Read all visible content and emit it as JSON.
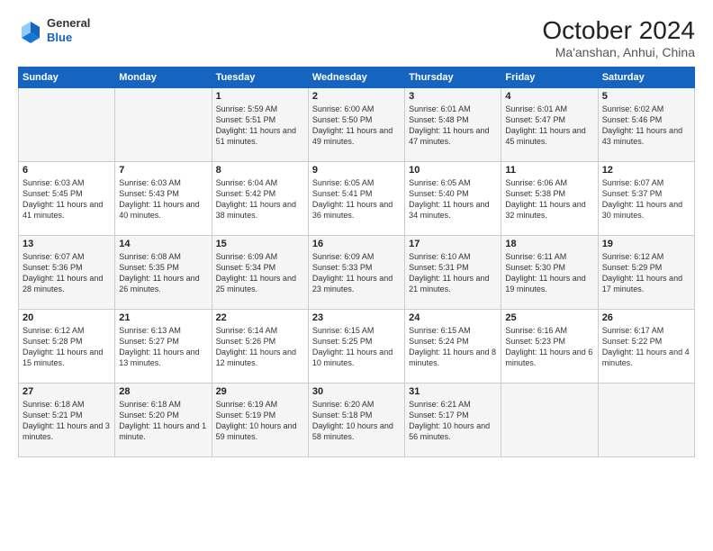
{
  "logo": {
    "general": "General",
    "blue": "Blue"
  },
  "title": {
    "month_year": "October 2024",
    "location": "Ma'anshan, Anhui, China"
  },
  "days_of_week": [
    "Sunday",
    "Monday",
    "Tuesday",
    "Wednesday",
    "Thursday",
    "Friday",
    "Saturday"
  ],
  "weeks": [
    [
      {
        "day": "",
        "info": ""
      },
      {
        "day": "",
        "info": ""
      },
      {
        "day": "1",
        "info": "Sunrise: 5:59 AM\nSunset: 5:51 PM\nDaylight: 11 hours and 51 minutes."
      },
      {
        "day": "2",
        "info": "Sunrise: 6:00 AM\nSunset: 5:50 PM\nDaylight: 11 hours and 49 minutes."
      },
      {
        "day": "3",
        "info": "Sunrise: 6:01 AM\nSunset: 5:48 PM\nDaylight: 11 hours and 47 minutes."
      },
      {
        "day": "4",
        "info": "Sunrise: 6:01 AM\nSunset: 5:47 PM\nDaylight: 11 hours and 45 minutes."
      },
      {
        "day": "5",
        "info": "Sunrise: 6:02 AM\nSunset: 5:46 PM\nDaylight: 11 hours and 43 minutes."
      }
    ],
    [
      {
        "day": "6",
        "info": "Sunrise: 6:03 AM\nSunset: 5:45 PM\nDaylight: 11 hours and 41 minutes."
      },
      {
        "day": "7",
        "info": "Sunrise: 6:03 AM\nSunset: 5:43 PM\nDaylight: 11 hours and 40 minutes."
      },
      {
        "day": "8",
        "info": "Sunrise: 6:04 AM\nSunset: 5:42 PM\nDaylight: 11 hours and 38 minutes."
      },
      {
        "day": "9",
        "info": "Sunrise: 6:05 AM\nSunset: 5:41 PM\nDaylight: 11 hours and 36 minutes."
      },
      {
        "day": "10",
        "info": "Sunrise: 6:05 AM\nSunset: 5:40 PM\nDaylight: 11 hours and 34 minutes."
      },
      {
        "day": "11",
        "info": "Sunrise: 6:06 AM\nSunset: 5:38 PM\nDaylight: 11 hours and 32 minutes."
      },
      {
        "day": "12",
        "info": "Sunrise: 6:07 AM\nSunset: 5:37 PM\nDaylight: 11 hours and 30 minutes."
      }
    ],
    [
      {
        "day": "13",
        "info": "Sunrise: 6:07 AM\nSunset: 5:36 PM\nDaylight: 11 hours and 28 minutes."
      },
      {
        "day": "14",
        "info": "Sunrise: 6:08 AM\nSunset: 5:35 PM\nDaylight: 11 hours and 26 minutes."
      },
      {
        "day": "15",
        "info": "Sunrise: 6:09 AM\nSunset: 5:34 PM\nDaylight: 11 hours and 25 minutes."
      },
      {
        "day": "16",
        "info": "Sunrise: 6:09 AM\nSunset: 5:33 PM\nDaylight: 11 hours and 23 minutes."
      },
      {
        "day": "17",
        "info": "Sunrise: 6:10 AM\nSunset: 5:31 PM\nDaylight: 11 hours and 21 minutes."
      },
      {
        "day": "18",
        "info": "Sunrise: 6:11 AM\nSunset: 5:30 PM\nDaylight: 11 hours and 19 minutes."
      },
      {
        "day": "19",
        "info": "Sunrise: 6:12 AM\nSunset: 5:29 PM\nDaylight: 11 hours and 17 minutes."
      }
    ],
    [
      {
        "day": "20",
        "info": "Sunrise: 6:12 AM\nSunset: 5:28 PM\nDaylight: 11 hours and 15 minutes."
      },
      {
        "day": "21",
        "info": "Sunrise: 6:13 AM\nSunset: 5:27 PM\nDaylight: 11 hours and 13 minutes."
      },
      {
        "day": "22",
        "info": "Sunrise: 6:14 AM\nSunset: 5:26 PM\nDaylight: 11 hours and 12 minutes."
      },
      {
        "day": "23",
        "info": "Sunrise: 6:15 AM\nSunset: 5:25 PM\nDaylight: 11 hours and 10 minutes."
      },
      {
        "day": "24",
        "info": "Sunrise: 6:15 AM\nSunset: 5:24 PM\nDaylight: 11 hours and 8 minutes."
      },
      {
        "day": "25",
        "info": "Sunrise: 6:16 AM\nSunset: 5:23 PM\nDaylight: 11 hours and 6 minutes."
      },
      {
        "day": "26",
        "info": "Sunrise: 6:17 AM\nSunset: 5:22 PM\nDaylight: 11 hours and 4 minutes."
      }
    ],
    [
      {
        "day": "27",
        "info": "Sunrise: 6:18 AM\nSunset: 5:21 PM\nDaylight: 11 hours and 3 minutes."
      },
      {
        "day": "28",
        "info": "Sunrise: 6:18 AM\nSunset: 5:20 PM\nDaylight: 11 hours and 1 minute."
      },
      {
        "day": "29",
        "info": "Sunrise: 6:19 AM\nSunset: 5:19 PM\nDaylight: 10 hours and 59 minutes."
      },
      {
        "day": "30",
        "info": "Sunrise: 6:20 AM\nSunset: 5:18 PM\nDaylight: 10 hours and 58 minutes."
      },
      {
        "day": "31",
        "info": "Sunrise: 6:21 AM\nSunset: 5:17 PM\nDaylight: 10 hours and 56 minutes."
      },
      {
        "day": "",
        "info": ""
      },
      {
        "day": "",
        "info": ""
      }
    ]
  ]
}
